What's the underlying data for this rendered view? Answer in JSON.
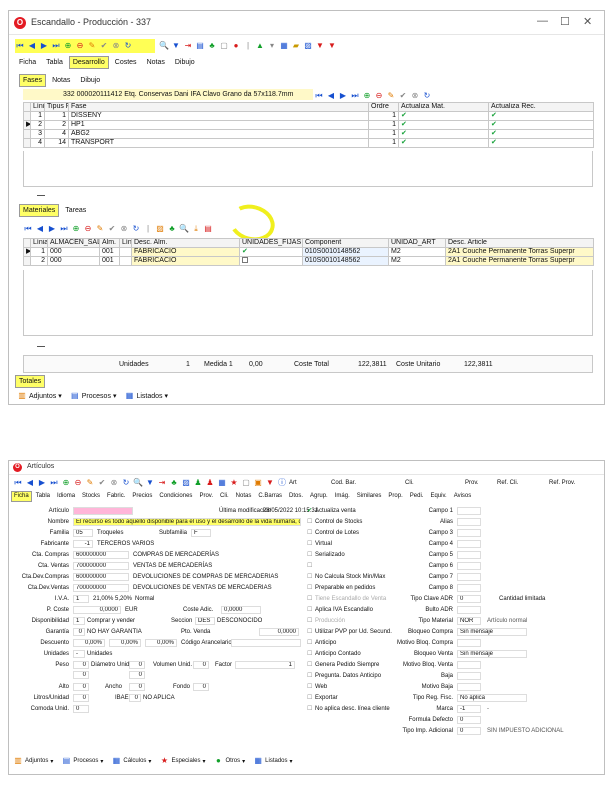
{
  "w1": {
    "title": "Escandallo - Producción - 337",
    "controls": [
      "—",
      "☐",
      "✕"
    ],
    "menu": [
      "Ficha",
      "Tabla",
      "Desarrollo",
      "Costes",
      "Notas",
      "Dibujo"
    ],
    "menu_active": 2,
    "subtabs": [
      "Fases",
      "Notas",
      "Dibujo"
    ],
    "subtabs_active": 0,
    "info_num": "332",
    "info_code": "000020111412",
    "info_desc": "Etq. Conservas Dani IFA Clavo Grano da 57x118.7mm",
    "fases_headers": [
      "Línia",
      "Tipus Fase",
      "Fase",
      "Ordre",
      "Actualiza Mat.",
      "Actualiza Rec."
    ],
    "fases_rows": [
      {
        "linia": "1",
        "tipus": "1",
        "fase": "DISSENY",
        "ordre": "1"
      },
      {
        "linia": "2",
        "tipus": "2",
        "fase": "HP1",
        "ordre": "1"
      },
      {
        "linia": "3",
        "tipus": "4",
        "fase": "ABG2",
        "ordre": "1"
      },
      {
        "linia": "4",
        "tipus": "14",
        "fase": "TRANSPORT",
        "ordre": "1"
      }
    ],
    "bottom_tabs": [
      "Materiales",
      "Tareas"
    ],
    "mat_headers": [
      "Línia",
      "ALMACEN_SAL",
      "Alm.",
      "Línia",
      "Desc. Alm.",
      "UNIDADES_FIJAS",
      "Component",
      "UNIDAD_ART",
      "Desc. Article"
    ],
    "mat_rows": [
      {
        "linia": "1",
        "almacen": "000",
        "alm": "001",
        "desc_alm": "FABRICACIÓ",
        "component": "010S0010148562",
        "unidad": "M2",
        "desc_art": "2A1 Couche Permanente Torras Superpr"
      },
      {
        "linia": "2",
        "almacen": "000",
        "alm": "001",
        "desc_alm": "FABRICACIÓ",
        "component": "010S0010148562",
        "unidad": "M2",
        "desc_art": "2A1 Couche Permanente Torras Superpr"
      }
    ],
    "totals": {
      "unidades_label": "Unidades",
      "unidades": "1",
      "medida_label": "Medida 1",
      "medida": "0,00",
      "coste_label": "Coste Total",
      "coste": "122,3811",
      "unit_label": "Coste Unitario",
      "unit": "122,3811"
    },
    "totales_tab": "Totales",
    "bottom_buttons": [
      "Adjuntos",
      "Procesos",
      "Listados"
    ]
  },
  "w2": {
    "title": "Artículos",
    "toolbar_art": "Art",
    "toolbar_codbar": "Cod. Bar.",
    "toolbar_cli": "Cli.",
    "toolbar_prov": "Prov.",
    "toolbar_refcli": "Ref. Cli.",
    "toolbar_refprov": "Ref. Prov.",
    "menu": [
      "Ficha",
      "Tabla",
      "Idioma",
      "Stocks",
      "Fabric.",
      "Precios",
      "Condiciones",
      "Prov.",
      "Cli.",
      "Notas",
      "C.Barras",
      "Dtos.",
      "Agrup.",
      "Imág.",
      "Similares",
      "Prop.",
      "Pedi.",
      "Equiv.",
      "Avisos"
    ],
    "left": {
      "articulo_label": "Artículo",
      "ultima_label": "Última modificación",
      "ultima": "28/05/2022 10:15:31",
      "nombre_label": "Nombre",
      "nombre": "El recurso es todo aquello disponible para el uso y el desarrollo de la vida humana, desde lo que",
      "familia_label": "Familia",
      "familia": "05",
      "familia_desc": "Troqueles",
      "subfamilia_label": "Subfamilia",
      "subfamilia": "F",
      "fabricante_label": "Fabricante",
      "fabricante": "-1",
      "fabricante_desc": "TERCEROS VARIOS",
      "cta_compras_label": "Cta. Compras",
      "cta_compras": "600000000",
      "cta_compras_desc": "COMPRAS DE MERCADERÍAS",
      "cta_ventas_label": "Cta. Ventas",
      "cta_ventas": "700000000",
      "cta_ventas_desc": "VENTAS DE MERCADERÍAS",
      "cta_dev_compras_label": "Cta.Dev.Compras",
      "cta_dev_compras": "600000000",
      "cta_dev_compras_desc": "DEVOLUCIONES DE COMPRAS DE MERCADERIAS",
      "cta_dev_ventas_label": "Cta.Dev.Ventas",
      "cta_dev_ventas": "700000000",
      "cta_dev_ventas_desc": "DEVOLUCIONES DE VENTAS DE MERCADERIAS",
      "iva_label": "I.V.A.",
      "iva": "1",
      "iva_pct": "21,00%",
      "iva_re": "5,20%",
      "iva_desc": "Normal",
      "pcoste_label": "P. Coste",
      "pcoste": "0,0000",
      "pcoste_cur": "EUR",
      "costeadic_label": "Coste Adic.",
      "costeadic": "0,0000",
      "disponibilidad_label": "Disponibilidad",
      "disponibilidad": "1",
      "disponibilidad_desc": "Comprar y vender",
      "seccion_label": "Seccion",
      "seccion": "DES",
      "seccion_desc": "DESCONOCIDO",
      "garantia_label": "Garantía",
      "garantia": "0",
      "garantia_desc": "NO HAY GARANTIA",
      "ptovenda_label": "Pto. Venda",
      "ptovenda": "0,0000",
      "descuento_label": "Descuento",
      "descuento1": "0,00%",
      "descuento2": "0,00%",
      "descuento3": "0,00%",
      "codarancel_label": "Código Arancelario",
      "unidades_label": "Unidades",
      "unidades": "-",
      "unidades_desc": "Unidades",
      "peso_label": "Peso",
      "peso": "0",
      "diametro_label": "Diámetro Unid.",
      "diametro": "0",
      "volumen_label": "Volumen Unid.",
      "volumen": "0",
      "factor_label": "Factor",
      "factor": "1",
      "peso2": "0",
      "diametro2": "0",
      "alto_label": "Alto",
      "alto": "0",
      "ancho_label": "Ancho",
      "ancho": "0",
      "fondo_label": "Fondo",
      "fondo": "0",
      "litros_label": "Litros/Unidad",
      "litros": "0",
      "ibae_label": "IBAE",
      "ibae": "0",
      "ibae_desc": "NO APLICA",
      "comoda_label": "Comoda Unid.",
      "comoda": "0"
    },
    "mid": [
      {
        "label": "Actualiza venta",
        "checked": true
      },
      {
        "label": "Control de Stocks",
        "checked": false
      },
      {
        "label": "Control de Lotes",
        "checked": false
      },
      {
        "label": "Virtual",
        "checked": false
      },
      {
        "label": "Serializado",
        "checked": false
      },
      {
        "label": "",
        "checked": false
      },
      {
        "label": "No Calcula Stock Min/Max",
        "checked": false
      },
      {
        "label": "Preparable en pedidos",
        "checked": false
      },
      {
        "label": "Tiene Escandallo de Venta",
        "checked": false,
        "disabled": true
      },
      {
        "label": "Aplica IVA Escandallo",
        "checked": false
      },
      {
        "label": "Producción",
        "checked": false,
        "disabled": true
      },
      {
        "label": "Utilizar PVP por Ud. Secund.",
        "checked": false
      },
      {
        "label": "Anticipo",
        "checked": false
      },
      {
        "label": "Anticipo Contado",
        "checked": false
      },
      {
        "label": "Genera Pedido Siempre",
        "checked": false
      },
      {
        "label": "Pregunta. Datos Anticipo",
        "checked": false
      },
      {
        "label": "Web",
        "checked": false
      },
      {
        "label": "Exportar",
        "checked": false
      },
      {
        "label": "No aplica desc. línea cliente",
        "checked": false
      }
    ],
    "right": [
      {
        "label": "Campo 1",
        "value": ""
      },
      {
        "label": "Alias",
        "value": ""
      },
      {
        "label": "Campo 3",
        "value": ""
      },
      {
        "label": "Campo 4",
        "value": ""
      },
      {
        "label": "Campo 5",
        "value": ""
      },
      {
        "label": "Campo 6",
        "value": ""
      },
      {
        "label": "Campo 7",
        "value": ""
      },
      {
        "label": "Campo 8",
        "value": ""
      },
      {
        "label": "Tipo Clave ADR",
        "value": "0",
        "extra_label": "Cantidad limitada"
      },
      {
        "label": "Bulto ADR",
        "value": ""
      },
      {
        "label": "Tipo Material",
        "value": "NOR",
        "extra_value": "Artículo normal"
      },
      {
        "label": "Bloqueo Compra",
        "value": "Sin mensaje"
      },
      {
        "label": "Motivo Bloq. Compra",
        "value": ""
      },
      {
        "label": "Bloqueo Venta",
        "value": "Sin mensaje"
      },
      {
        "label": "Motivo Bloq. Venta",
        "value": ""
      },
      {
        "label": "Baja",
        "value": ""
      },
      {
        "label": "Motivo Baja",
        "value": ""
      },
      {
        "label": "Tipo Reg. Fisc.",
        "value": "No aplica"
      },
      {
        "label": "Marca",
        "value": "-1",
        "extra_value": "-"
      },
      {
        "label": "Formula Defecto",
        "value": "0"
      },
      {
        "label": "Tipo Imp. Adicional",
        "value": "0",
        "extra_value": "SIN IMPUESTO ADICIONAL"
      }
    ],
    "bottom_buttons": [
      "Adjuntos",
      "Procesos",
      "Cálculos",
      "Especiales",
      "Otros",
      "Listados"
    ]
  }
}
